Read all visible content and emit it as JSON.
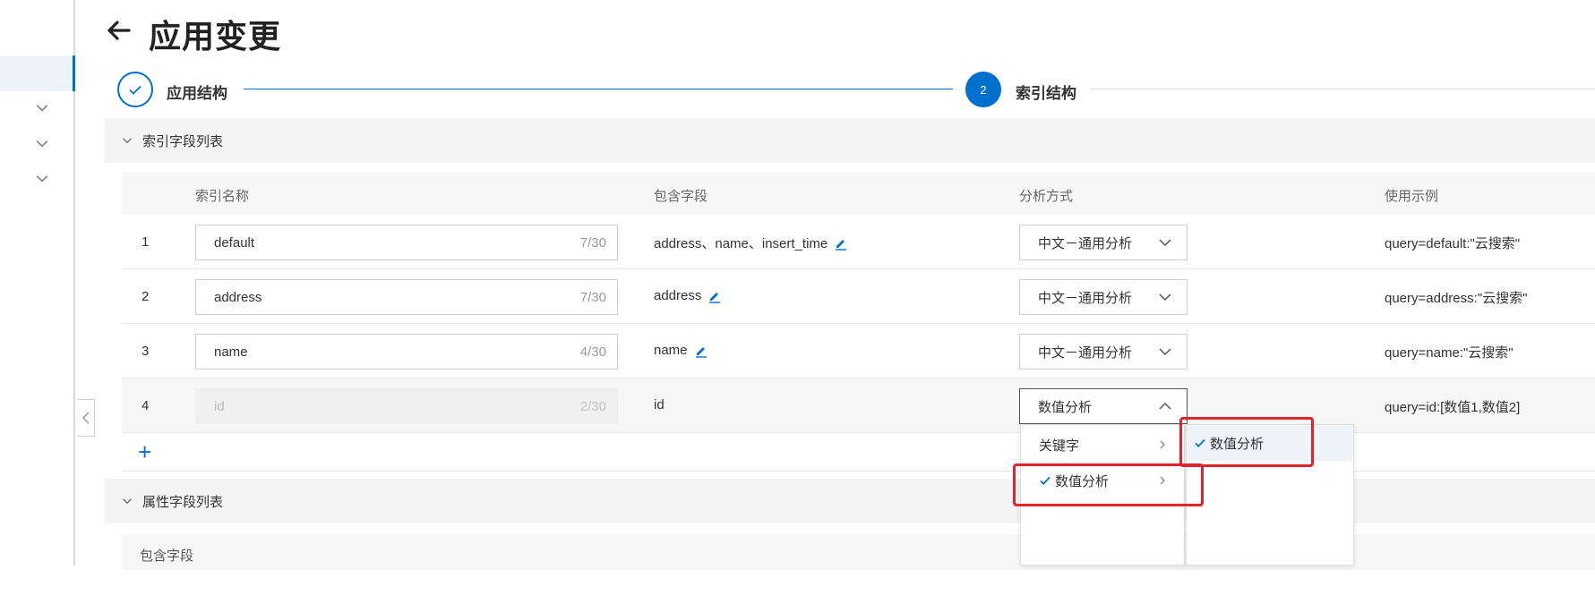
{
  "page": {
    "title": "应用变更"
  },
  "steps": [
    {
      "label": "应用结构",
      "state": "done"
    },
    {
      "label": "索引结构",
      "number": "2",
      "state": "active"
    }
  ],
  "index_section": {
    "title": "索引字段列表",
    "columns": [
      "索引名称",
      "包含字段",
      "分析方式",
      "使用示例"
    ],
    "rows": [
      {
        "idx": "1",
        "name": "default",
        "count": "7/30",
        "fields": "address、name、insert_time",
        "editable": true,
        "analyzer": "中文－通用分析",
        "example": "query=default:\"云搜索\""
      },
      {
        "idx": "2",
        "name": "address",
        "count": "7/30",
        "fields": "address",
        "editable": true,
        "analyzer": "中文－通用分析",
        "example": "query=address:\"云搜索\""
      },
      {
        "idx": "3",
        "name": "name",
        "count": "4/30",
        "fields": "name",
        "editable": true,
        "analyzer": "中文－通用分析",
        "example": "query=name:\"云搜索\""
      },
      {
        "idx": "4",
        "name": "id",
        "count": "2/30",
        "fields": "id",
        "editable": false,
        "analyzer": "数值分析",
        "example": "query=id:[数值1,数值2]"
      }
    ],
    "add_label": "+"
  },
  "cascader": {
    "level1": [
      {
        "label": "关键字",
        "selected": false
      },
      {
        "label": "数值分析",
        "selected": true
      }
    ],
    "level2": [
      {
        "label": "数值分析",
        "selected": true
      }
    ]
  },
  "attr_section": {
    "title": "属性字段列表",
    "column": "包含字段"
  },
  "colors": {
    "accent": "#0070cc",
    "highlight": "#e0242b",
    "section_bg": "#f4f4f4"
  }
}
